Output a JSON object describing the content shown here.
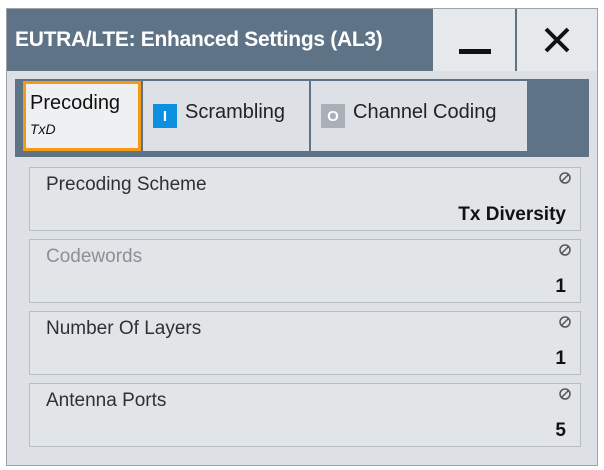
{
  "window": {
    "title": "EUTRA/LTE: Enhanced Settings (AL3)",
    "minimize_icon": "minimize-icon",
    "close_icon": "close-icon"
  },
  "tabs": [
    {
      "label": "Precoding",
      "sublabel": "TxD",
      "selected": true
    },
    {
      "label": "Scrambling",
      "indicator": "I",
      "indicator_state": "on"
    },
    {
      "label": "Channel Coding",
      "indicator": "O",
      "indicator_state": "off"
    }
  ],
  "fields": [
    {
      "label": "Precoding Scheme",
      "value": "Tx Diversity",
      "enabled": true
    },
    {
      "label": "Codewords",
      "value": "1",
      "enabled": false
    },
    {
      "label": "Number Of Layers",
      "value": "1",
      "enabled": true
    },
    {
      "label": "Antenna Ports",
      "value": "5",
      "enabled": true
    }
  ],
  "colors": {
    "titlebar": "#5e7386",
    "selected_tab_border": "#f59a16",
    "indicator_on": "#0e90e0",
    "indicator_off": "#a9b0b8"
  }
}
